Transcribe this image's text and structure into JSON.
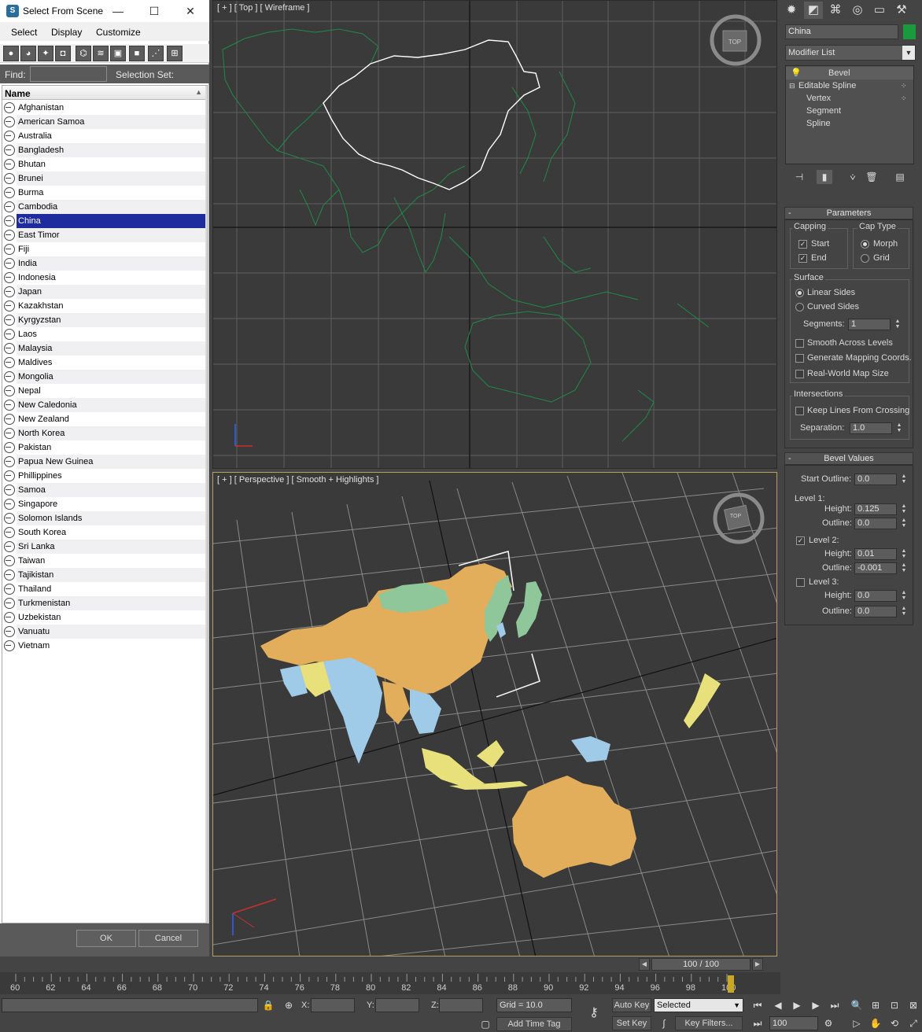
{
  "dialog": {
    "title": "Select From Scene",
    "window_buttons": {
      "minimize": "—",
      "maximize": "☐",
      "close": "✕"
    },
    "menu": [
      "Select",
      "Display",
      "Customize"
    ],
    "find_label": "Find:",
    "find_value": "",
    "selection_set_label": "Selection Set:",
    "column_header": "Name",
    "items": [
      "Afghanistan",
      "American Samoa",
      "Australia",
      "Bangladesh",
      "Bhutan",
      "Brunei",
      "Burma",
      "Cambodia",
      "China",
      "East Timor",
      "Fiji",
      "India",
      "Indonesia",
      "Japan",
      "Kazakhstan",
      "Kyrgyzstan",
      "Laos",
      "Malaysia",
      "Maldives",
      "Mongolia",
      "Nepal",
      "New Caledonia",
      "New Zealand",
      "North Korea",
      "Pakistan",
      "Papua New Guinea",
      "Phillippines",
      "Samoa",
      "Singapore",
      "Solomon Islands",
      "South Korea",
      "Sri Lanka",
      "Taiwan",
      "Tajikistan",
      "Thailand",
      "Turkmenistan",
      "Uzbekistan",
      "Vanuatu",
      "Vietnam"
    ],
    "selected_item": "China",
    "ok_label": "OK",
    "cancel_label": "Cancel"
  },
  "viewports": {
    "top_label": "[ + ] [ Top ] [ Wireframe ]",
    "persp_label": "[ + ] [ Perspective ] [ Smooth + Highlights ]",
    "viewcube_label": "TOP"
  },
  "command_panel": {
    "object_name": "China",
    "object_color": "#1a9a3c",
    "modifier_list": "Modifier List",
    "stack": {
      "bevel": "Bevel",
      "editable_spline": "Editable Spline",
      "vertex": "Vertex",
      "segment": "Segment",
      "spline": "Spline"
    },
    "parameters": {
      "title": "Parameters",
      "capping": "Capping",
      "start": "Start",
      "end": "End",
      "cap_type": "Cap Type",
      "morph": "Morph",
      "grid": "Grid",
      "surface": "Surface",
      "linear_sides": "Linear Sides",
      "curved_sides": "Curved Sides",
      "segments_label": "Segments:",
      "segments_value": "1",
      "smooth_across_levels": "Smooth Across Levels",
      "generate_mapping": "Generate Mapping Coords.",
      "real_world": "Real-World Map Size",
      "intersections": "Intersections",
      "keep_lines": "Keep Lines From Crossing",
      "separation_label": "Separation:",
      "separation_value": "1.0"
    },
    "bevel_values": {
      "title": "Bevel Values",
      "start_outline_label": "Start Outline:",
      "start_outline_value": "0.0",
      "level1": "Level 1:",
      "l1_height_label": "Height:",
      "l1_height": "0.125",
      "l1_outline_label": "Outline:",
      "l1_outline": "0.0",
      "level2": "Level 2:",
      "l2_height_label": "Height:",
      "l2_height": "0.01",
      "l2_outline_label": "Outline:",
      "l2_outline": "-0.001",
      "level3": "Level 3:",
      "l3_height_label": "Height:",
      "l3_height": "0.0",
      "l3_outline_label": "Outline:",
      "l3_outline": "0.0"
    }
  },
  "time_slider": {
    "value": "100 / 100"
  },
  "trackbar": {
    "ticks": [
      "60",
      "62",
      "64",
      "66",
      "68",
      "70",
      "72",
      "74",
      "76",
      "78",
      "80",
      "82",
      "84",
      "86",
      "88",
      "90",
      "92",
      "94",
      "96",
      "98",
      "100"
    ]
  },
  "status": {
    "x_label": "X:",
    "y_label": "Y:",
    "z_label": "Z:",
    "grid": "Grid = 10.0",
    "add_time_tag": "Add Time Tag",
    "auto_key": "Auto Key",
    "set_key": "Set Key",
    "selected": "Selected",
    "key_filters": "Key Filters...",
    "frame": "100"
  }
}
